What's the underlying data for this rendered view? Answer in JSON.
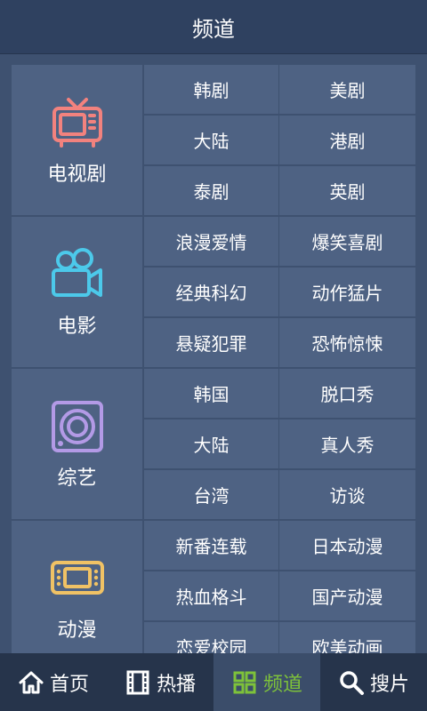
{
  "header": {
    "title": "频道"
  },
  "sections": [
    {
      "label": "电视剧",
      "icon": "tv-icon",
      "color": "#f2827e",
      "items": [
        "韩剧",
        "美剧",
        "大陆",
        "港剧",
        "泰剧",
        "英剧"
      ]
    },
    {
      "label": "电影",
      "icon": "movie-camera-icon",
      "color": "#4cc9ea",
      "items": [
        "浪漫爱情",
        "爆笑喜剧",
        "经典科幻",
        "动作猛片",
        "悬疑犯罪",
        "恐怖惊悚"
      ]
    },
    {
      "label": "综艺",
      "icon": "speaker-icon",
      "color": "#b39ae6",
      "items": [
        "韩国",
        "脱口秀",
        "大陆",
        "真人秀",
        "台湾",
        "访谈"
      ]
    },
    {
      "label": "动漫",
      "icon": "gameboy-icon",
      "color": "#f0c265",
      "items": [
        "新番连载",
        "日本动漫",
        "热血格斗",
        "国产动漫",
        "恋爱校园",
        "欧美动画"
      ]
    }
  ],
  "tabbar": {
    "tabs": [
      {
        "label": "首页",
        "icon": "home-icon",
        "active": false
      },
      {
        "label": "热播",
        "icon": "film-icon",
        "active": false
      },
      {
        "label": "频道",
        "icon": "grid-icon",
        "active": true
      },
      {
        "label": "搜片",
        "icon": "search-icon",
        "active": false
      }
    ],
    "active_color": "#7ec23a"
  }
}
